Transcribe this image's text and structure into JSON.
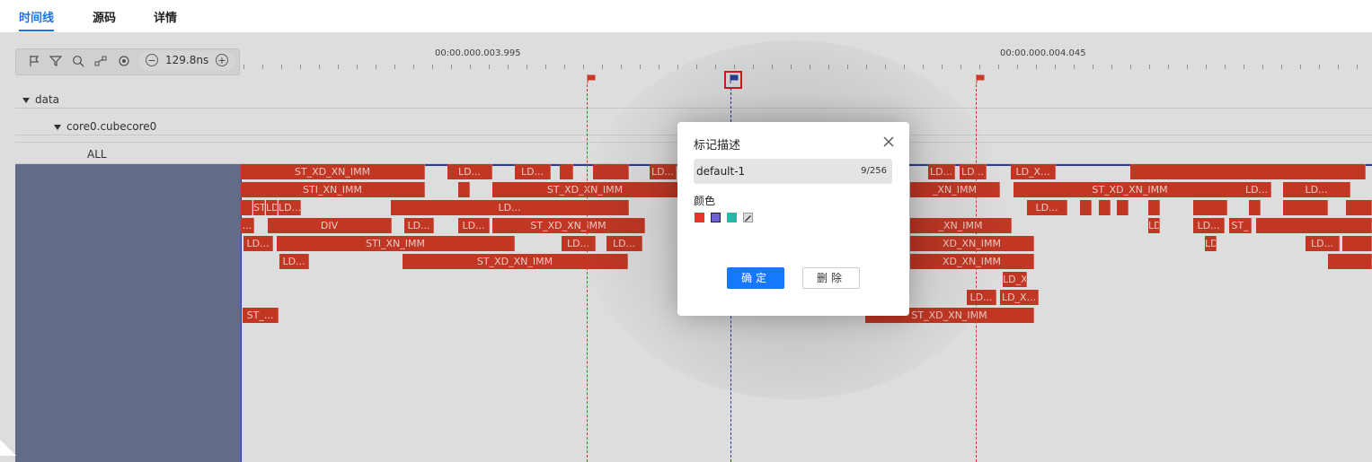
{
  "tabs": [
    {
      "label": "时间线",
      "active": true
    },
    {
      "label": "源码",
      "active": false
    },
    {
      "label": "详情",
      "active": false
    }
  ],
  "toolbar": {
    "icons": [
      "flag-icon",
      "filter-icon",
      "search-icon",
      "link-icon",
      "target-icon"
    ],
    "zoom_value": "129.8ns",
    "zoom_out": "−",
    "zoom_in": "+"
  },
  "ruler": {
    "labels": [
      "00:00.000.003.995",
      "00:00.000.004.045"
    ]
  },
  "tree": {
    "root": "data",
    "child": "core0.cubecore0",
    "leaf": "ALL"
  },
  "lanes": [
    [
      "ST_XD_XN_IMM",
      "LD...",
      "LD...",
      "",
      "",
      "LD...",
      "LD...",
      "LD...",
      "LD_X...",
      "",
      "ST_XD_XN_IMM"
    ],
    [
      "STI_XN_IMM",
      "",
      "ST_XD_XN_IMM",
      "_XN_IMM",
      "ST_XD_XN_IMM",
      "LD...",
      "LD..."
    ],
    [
      "",
      "ST_XD_XN_IMM",
      "LD_X...",
      "LD...",
      "LD...",
      "LD..."
    ],
    [
      "...",
      "DIV",
      "LD...",
      "LD...",
      "ST_XD_XN_IMM",
      "_XN_IMM",
      "LD...",
      "LD...",
      "ST_"
    ],
    [
      "LD...",
      "STI_XN_IMM",
      "LD...",
      "LD...",
      "XD_XN_IMM",
      "LD...",
      "LD..."
    ],
    [
      "LD...",
      "ST_XD_XN_IMM",
      "XD_XN_IMM"
    ],
    [
      "LD_X..."
    ],
    [
      "LD...",
      "LD_X..."
    ],
    [
      "ST_...",
      "ST_XD_XN_IMM"
    ]
  ],
  "colors": {
    "accent": "#1677ff",
    "block": "#c93a26",
    "flag_red": "#d43a2a",
    "flag_blue": "#2e3f9e",
    "swatches": [
      "#e8352a",
      "#6f60d6",
      "#27b7a8"
    ]
  },
  "dialog": {
    "title": "标记描述",
    "input_value": "default-1",
    "char_count": "9/256",
    "color_label": "颜色",
    "ok_label": "确定",
    "delete_label": "删除"
  }
}
